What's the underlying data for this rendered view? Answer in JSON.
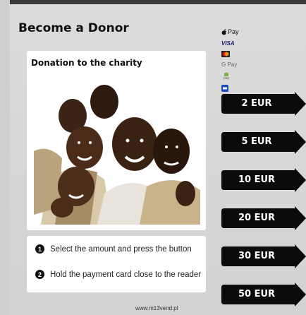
{
  "header": {
    "title": "Become a Donor"
  },
  "charity": {
    "title": "Donation to the charity"
  },
  "payments": [
    {
      "name": "apple-pay-icon",
      "label": "Pay"
    },
    {
      "name": "visa-icon",
      "label": "VISA"
    },
    {
      "name": "mastercard-icon",
      "label": ""
    },
    {
      "name": "google-pay-icon",
      "label": "G Pay"
    },
    {
      "name": "android-pay-icon",
      "label": "pay"
    },
    {
      "name": "samsung-pay-icon",
      "label": ""
    }
  ],
  "amounts": [
    {
      "label": "2 EUR"
    },
    {
      "label": "5 EUR"
    },
    {
      "label": "10 EUR"
    },
    {
      "label": "20 EUR"
    },
    {
      "label": "30 EUR"
    },
    {
      "label": "50 EUR"
    }
  ],
  "steps": [
    {
      "num": "1",
      "text": "Select the amount and press the button"
    },
    {
      "num": "2",
      "text": "Hold the payment card close to the reader"
    }
  ],
  "footer": {
    "url": "www.m13vend.pl"
  },
  "colors": {
    "button": "#0b0b0b",
    "text": "#111111",
    "card": "#ffffff"
  }
}
